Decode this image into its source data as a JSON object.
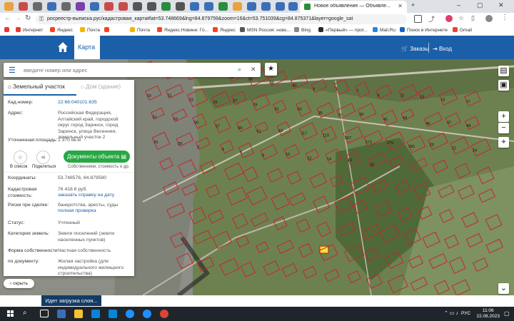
{
  "browser": {
    "active_tab_title": "Новое объявление — Объявле...",
    "url": "росреестр-выписка.рус/кадастровая_карта#lat=53.748669&lng=84.879759&zoom=16&ct=53.751039&cg=84.875371&layer=google_sat",
    "bookmarks": [
      "Интернет",
      "Яндекс",
      "Почта",
      "Почта",
      "Яндекс.Новини: Го...",
      "Яндекс",
      "MSN Россия: ново...",
      "Bing",
      "«Первый» — прог...",
      "Mail.Ru",
      "Поиск в Интернете",
      "Gmail"
    ]
  },
  "site": {
    "map_tab": "Карта",
    "orders": "Заказы",
    "login": "Вход"
  },
  "search": {
    "placeholder": "введите номер или адрес"
  },
  "panel": {
    "tab_land": "Земельный участок",
    "tab_building": "Дом (здание)",
    "cad_label": "Кад.номер:",
    "cad_value": "22:66:040101:635",
    "addr_label": "Адрес:",
    "addr_value": "Российская Федерация, Алтайский край, городской округ город Заринск, город Заринск, улица Весенняя, земельный участок 2",
    "area_label": "Уточненная площадь:",
    "area_value": "1 370 кв.м",
    "list_btn": "В список",
    "share_btn": "Поделиться",
    "docs_btn": "Документы объекта",
    "docs_sub": "Собственники, стоимость и др.",
    "coords_label": "Координаты:",
    "coords_value": "53.748576, 84.879580",
    "cost_label": "Кадастровая стоимость:",
    "cost_value": "76 418.6 руб.",
    "cost_link": "заказать справку на дату",
    "risk_label": "Риски при сделке:",
    "risk_value": "банкротства, аресты, суды",
    "risk_link": "полная проверка",
    "status_label": "Статус:",
    "status_value": "Учтенный",
    "cat_label": "Категория земель:",
    "cat_value": "Земли поселений (земли населенных пунктов)",
    "own_label": "Форма собственности:",
    "own_value": "Частная собственность",
    "doc_label": "по документу:",
    "doc_value": "Жилая застройка (для индивидуального жилищного строительства)"
  },
  "map": {
    "hide_btn": "скрыть",
    "loading": "Идет загрузка слоя...",
    "plots": [
      "26",
      "28",
      "30",
      "32",
      "34",
      "36",
      "38",
      "40",
      "3",
      "5",
      "7",
      "9",
      "11",
      "13",
      "15",
      "17",
      "19",
      "21",
      "23",
      "25",
      "27",
      "29",
      "31",
      "33",
      "35",
      "37",
      "39",
      "41",
      "43",
      "45",
      "47",
      "49",
      "51",
      "53",
      "55",
      "57",
      "59",
      "61",
      "63",
      "117",
      "119",
      "267",
      "273",
      "275",
      "281",
      "20",
      "22",
      "24",
      "26",
      "28",
      "2",
      "4",
      "6",
      "8",
      "10",
      "12",
      "14",
      "16",
      "18"
    ]
  },
  "taskbar": {
    "lang": "РУС",
    "time": "11:06",
    "date": "22.06.2023"
  }
}
